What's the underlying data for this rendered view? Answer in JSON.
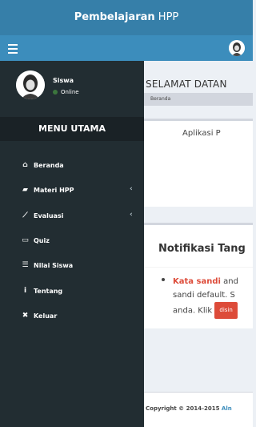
{
  "header": {
    "brand_bold": "Pembelajaran",
    "brand_rest": " HPP"
  },
  "user": {
    "name": "Siswa",
    "status": "Online"
  },
  "sidebar": {
    "menu_header": "MENU UTAMA",
    "items": [
      {
        "label": "Beranda",
        "icon": "home-icon",
        "glyph": "⌂",
        "has_chevron": false
      },
      {
        "label": "Materi HPP",
        "icon": "book-icon",
        "glyph": "▰",
        "has_chevron": true
      },
      {
        "label": "Evaluasi",
        "icon": "line-chart-icon",
        "glyph": "⟋",
        "has_chevron": true
      },
      {
        "label": "Quiz",
        "icon": "calendar-icon",
        "glyph": "▭",
        "has_chevron": false
      },
      {
        "label": "Nilai Siswa",
        "icon": "list-icon",
        "glyph": "☰",
        "has_chevron": false
      },
      {
        "label": "Tentang",
        "icon": "info-icon",
        "glyph": "i",
        "has_chevron": false
      },
      {
        "label": "Keluar",
        "icon": "close-icon",
        "glyph": "✖",
        "has_chevron": false
      }
    ]
  },
  "content": {
    "title": "SELAMAT DATAN",
    "breadcrumb": "Beranda",
    "box1_title": "Aplikasi P",
    "box2_title": "Notifikasi Tang",
    "notification": {
      "line1_red": "Kata sandi",
      "line1_rest": " and",
      "line2": "sandi default. S",
      "line3": "anda. Klik ",
      "button_label": "disin"
    },
    "footer_text": "Copyright © 2014-2015 ",
    "footer_link": "Aln"
  },
  "colors": {
    "header": "#3c8dbc",
    "sidebar": "#222d32",
    "accent_red": "#dd4b39"
  }
}
